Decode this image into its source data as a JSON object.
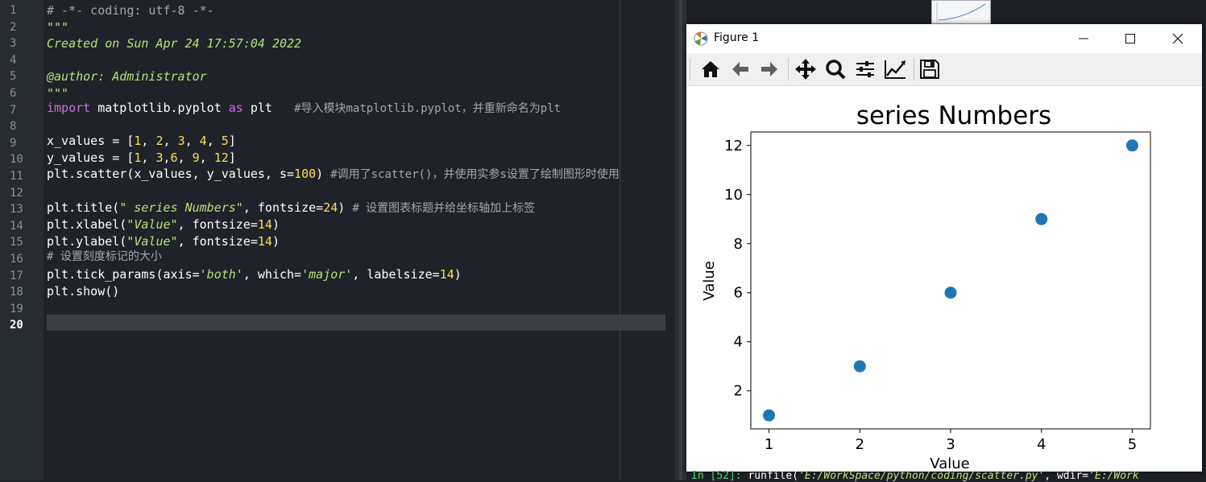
{
  "editor": {
    "line_numbers": [
      "1",
      "2",
      "3",
      "4",
      "5",
      "6",
      "7",
      "8",
      "9",
      "10",
      "11",
      "12",
      "13",
      "14",
      "15",
      "16",
      "17",
      "18",
      "19",
      "20"
    ],
    "active_line": "20",
    "code": {
      "l1": "# -*- coding: utf-8 -*-",
      "l2": "\"\"\"",
      "l3": "Created on Sun Apr 24 17:57:04 2022",
      "l5": "@author: Administrator",
      "l6": "\"\"\"",
      "l7_kw1": "import",
      "l7_mod": " matplotlib.pyplot ",
      "l7_kw2": "as",
      "l7_alias": " plt   ",
      "l7_cmt": "#导入模块matplotlib.pyplot，并重新命名为plt",
      "l9_a": "x_values = [",
      "l9_n": [
        "1",
        "2",
        "3",
        "4",
        "5"
      ],
      "l10_a": "y_values = [",
      "l10_n": [
        "1",
        "3",
        "6",
        "9",
        "12"
      ],
      "l11_a": "plt.scatter(x_values, y_values, s=",
      "l11_n": "100",
      "l11_b": ") ",
      "l11_cmt": "#调用了scatter()，并使用实参s设置了绘制图形时使用",
      "l13_a": "plt.title(",
      "l13_s": "\" series Numbers\"",
      "l13_b": ", fontsize=",
      "l13_n": "24",
      "l13_c": ") ",
      "l13_cmt": "# 设置图表标题并给坐标轴加上标签",
      "l14_a": "plt.xlabel(",
      "l14_s": "\"Value\"",
      "l14_b": ", fontsize=",
      "l14_n": "14",
      "l14_c": ")",
      "l15_a": "plt.ylabel(",
      "l15_s": "\"Value\"",
      "l15_b": ", fontsize=",
      "l15_n": "14",
      "l15_c": ")",
      "l16_cmt": "# 设置刻度标记的大小",
      "l17_a": "plt.tick_params(axis=",
      "l17_s1": "'both'",
      "l17_b": ", which=",
      "l17_s2": "'major'",
      "l17_c": ", labelsize=",
      "l17_n": "14",
      "l17_d": ")",
      "l18": "plt.show()"
    }
  },
  "figure_window": {
    "title": "Figure 1",
    "toolbar_icons": [
      "home-icon",
      "back-arrow-icon",
      "forward-arrow-icon",
      "pan-icon",
      "zoom-icon",
      "subplots-config-icon",
      "axes-edit-icon",
      "save-icon"
    ]
  },
  "console": {
    "prompt_in": "In [",
    "prompt_num": "52",
    "prompt_close": "]: ",
    "cmd": "runfile(",
    "path": "'E:/WorkSpace/python/coding/scatter.py'",
    "sep": ", wdir=",
    "wdir": "'E:/Work"
  },
  "chart_data": {
    "type": "scatter",
    "title": "series Numbers",
    "xlabel": "Value",
    "ylabel": "Value",
    "x": [
      1,
      2,
      3,
      4,
      5
    ],
    "y": [
      1,
      3,
      6,
      9,
      12
    ],
    "xlim": [
      0.8,
      5.2
    ],
    "ylim": [
      0.45,
      12.55
    ],
    "xticks": [
      1,
      2,
      3,
      4,
      5
    ],
    "yticks": [
      2,
      4,
      6,
      8,
      10,
      12
    ],
    "marker_color": "#1f77b4",
    "grid": false
  }
}
